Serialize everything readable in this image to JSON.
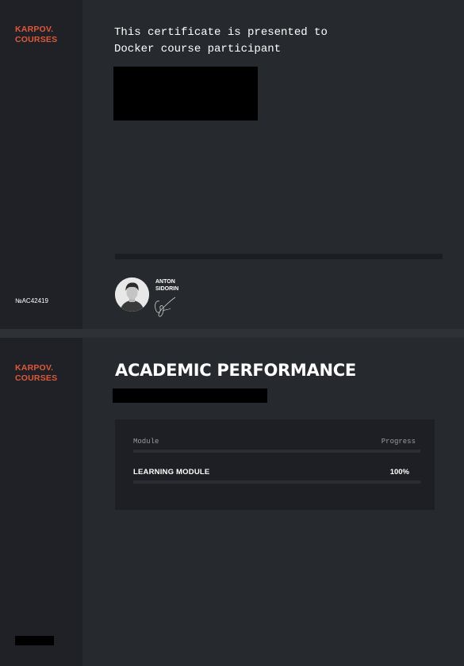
{
  "certificate": {
    "logo": {
      "line1": "KARPOV.",
      "line2": "COURSES"
    },
    "intro_line1": "This certificate is presented to",
    "intro_line2": "Docker course participant",
    "number": "№AC42419",
    "signer": {
      "first": "ANTON",
      "last": "SIDORIN"
    }
  },
  "performance": {
    "logo": {
      "line1": "KARPOV.",
      "line2": "COURSES"
    },
    "title": "ACADEMIC PERFORMANCE",
    "table": {
      "headers": {
        "module": "Module",
        "progress": "Progress"
      },
      "rows": [
        {
          "module": "LEARNING MODULE",
          "progress": "100%"
        }
      ]
    }
  },
  "colors": {
    "accent": "#e0583b",
    "page_bg": "#26292e",
    "sidebar_bg": "#1f2126",
    "card_bg": "#1d1f24"
  }
}
